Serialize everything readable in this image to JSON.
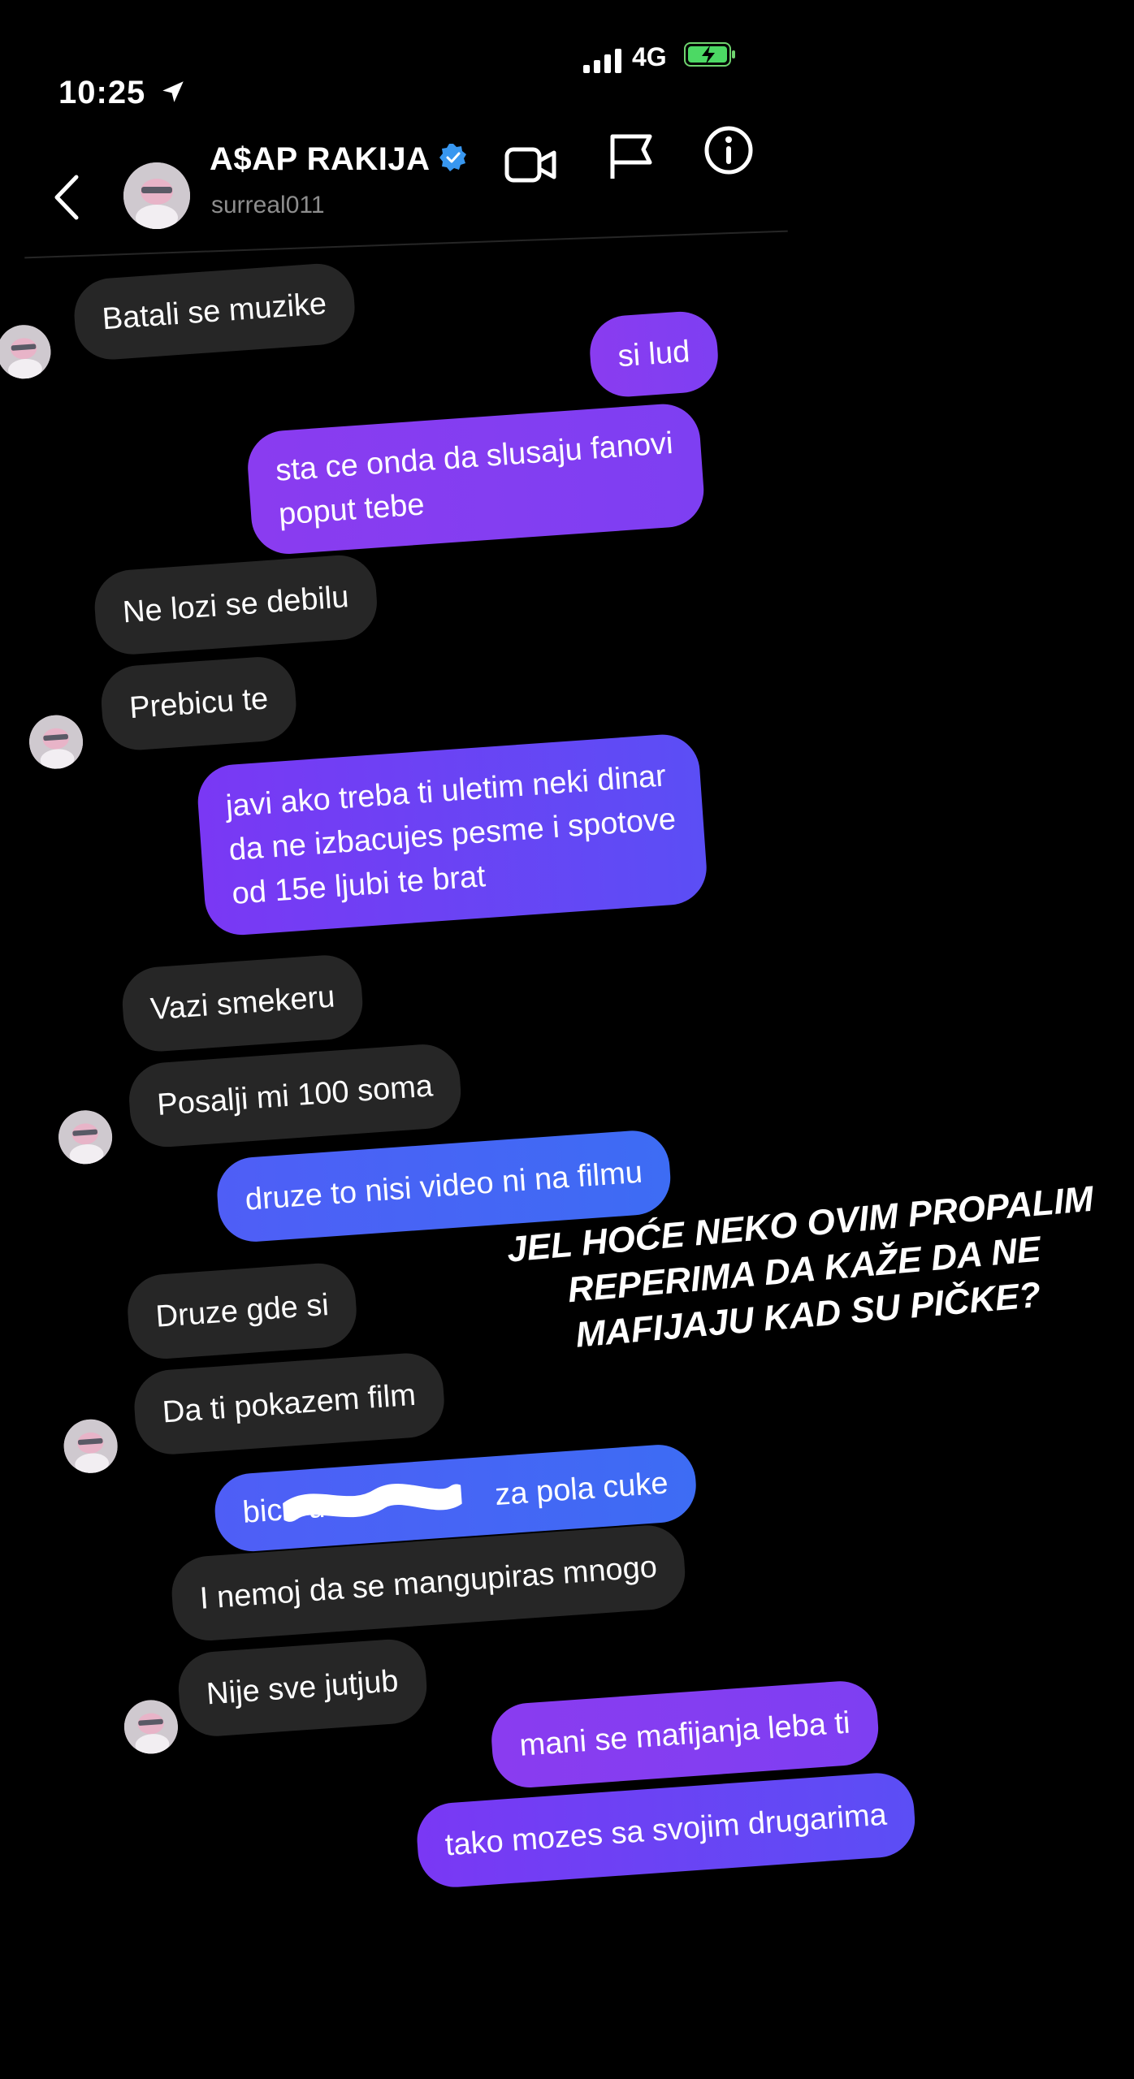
{
  "status_bar": {
    "time": "10:25",
    "network": "4G",
    "location_icon": "location-arrow-icon",
    "signal_icon": "signal-bars-icon",
    "battery_icon": "battery-charging-icon"
  },
  "header": {
    "back_icon": "chevron-left-icon",
    "display_name": "A$AP RAKIJA",
    "verified_icon": "verified-badge-icon",
    "username": "surreal011",
    "actions": [
      "video-call-icon",
      "flag-icon",
      "info-icon"
    ]
  },
  "colors": {
    "background": "#000000",
    "incoming_bubble": "#262626",
    "outgoing_purple": "#8a3cf0",
    "outgoing_blue": "#3d6cf4",
    "verified_blue": "#3897f0"
  },
  "messages": [
    {
      "from": "them",
      "text": "Batali se muzike"
    },
    {
      "from": "me",
      "text": "si lud"
    },
    {
      "from": "me",
      "text": "sta ce onda da slusaju fanovi"
    },
    {
      "from": "me",
      "text": "poput tebe"
    },
    {
      "from": "them",
      "text": "Ne lozi se debilu"
    },
    {
      "from": "them",
      "text": "Prebicu te"
    },
    {
      "from": "me",
      "text": "javi ako treba ti uletim neki dinar"
    },
    {
      "from": "me",
      "text": "da ne izbacujes pesme i spotove"
    },
    {
      "from": "me",
      "text": "od 15e ljubi te brat"
    },
    {
      "from": "them",
      "text": "Vazi smekeru"
    },
    {
      "from": "them",
      "text": "Posalji mi 100 soma"
    },
    {
      "from": "me",
      "text": "druze to nisi video ni na filmu"
    },
    {
      "from": "them",
      "text": "Druze gde si"
    },
    {
      "from": "them",
      "text": "Da ti pokazem film"
    },
    {
      "from": "me",
      "text": "bicu u",
      "tail": "za pola cuke"
    },
    {
      "from": "them",
      "text": "I nemoj da se mangupiras mnogo"
    },
    {
      "from": "them",
      "text": "Nije sve jutjub"
    },
    {
      "from": "me",
      "text": "mani se mafijanja leba ti"
    },
    {
      "from": "me",
      "text": "tako mozes sa svojim drugarima"
    }
  ],
  "overlay_caption": {
    "line1": "JEL HOĆE NEKO OVIM PROPALIM",
    "line2": "REPERIMA DA KAŽE DA NE",
    "line3": "MAFIJAJU KAD SU PIČKE?"
  }
}
